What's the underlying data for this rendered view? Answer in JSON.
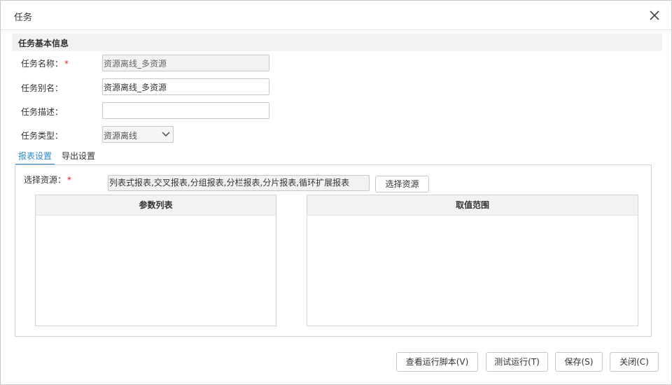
{
  "dialog": {
    "title": "任务"
  },
  "basic_info": {
    "section_title": "任务基本信息",
    "name_label": "任务名称：",
    "name_value": "资源离线_多资源",
    "alias_label": "任务别名：",
    "alias_value": "资源离线_多资源",
    "desc_label": "任务描述：",
    "desc_value": "",
    "type_label": "任务类型：",
    "type_value": "资源离线",
    "required_mark": "*"
  },
  "tabs": [
    {
      "label": "报表设置",
      "active": true
    },
    {
      "label": "导出设置",
      "active": false
    }
  ],
  "report_settings": {
    "resource_label": "选择资源：",
    "required_mark": "*",
    "resource_value": "列表式报表,交叉报表,分组报表,分栏报表,分片报表,循环扩展报表",
    "select_button": "选择资源",
    "param_list_header": "参数列表",
    "value_range_header": "取值范围"
  },
  "footer": {
    "view_script": "查看运行脚本(V)",
    "test_run": "测试运行(T)",
    "save": "保存(S)",
    "close": "关闭(C)"
  },
  "colors": {
    "accent": "#2a8bc9",
    "required": "#e02020",
    "header_bg": "#f2f2f2"
  },
  "icons": {
    "close": "close-icon",
    "dropdown": "chevron-down-icon"
  }
}
